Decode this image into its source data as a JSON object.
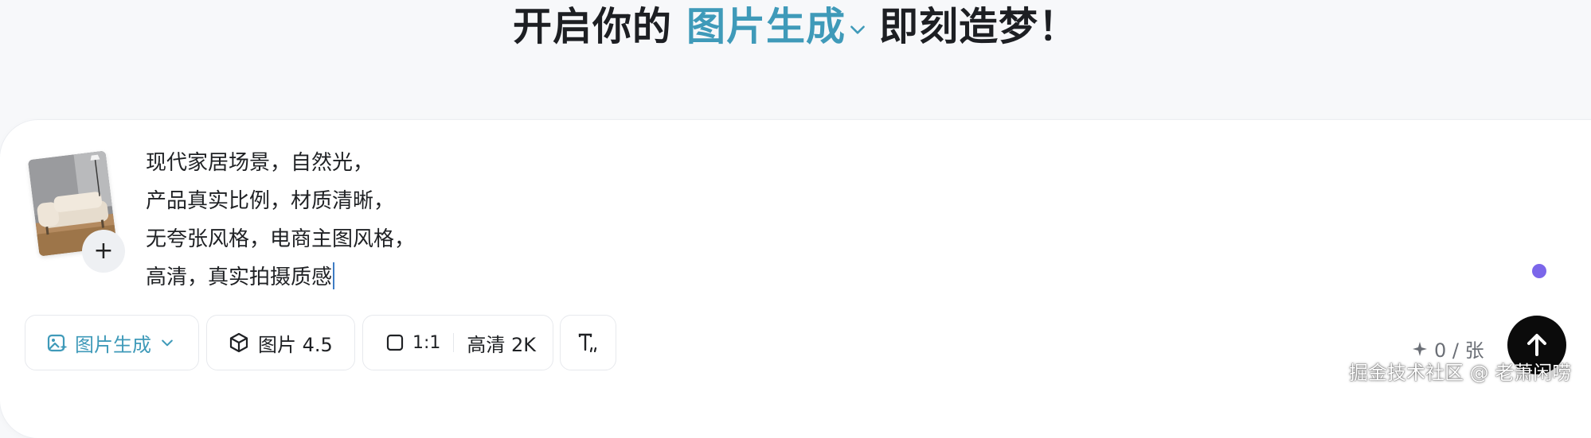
{
  "header": {
    "prefix": "开启你的",
    "mode_link": "图片生成",
    "suffix": "即刻造梦！"
  },
  "colors": {
    "accent": "#3f9ab9",
    "send_button": "#0b0b0b",
    "status_dot": "#7b66ea"
  },
  "composer": {
    "prompt_lines": [
      "现代家居场景，自然光，",
      "产品真实比例，材质清晰，",
      "无夸张风格，电商主图风格，",
      "高清，真实拍摄质感"
    ],
    "add_image_label": "+"
  },
  "toolbar": {
    "mode": "图片生成",
    "model": "图片 4.5",
    "ratio": "1:1",
    "quality": "高清 2K",
    "credits": "0 / 张",
    "icons": {
      "mode": "image-sparkle-icon",
      "model": "cube-icon",
      "ratio": "square-icon",
      "text": "text-style-icon",
      "credits": "sparkle-icon",
      "send": "arrow-up-icon"
    }
  },
  "watermark": "掘金技术社区 @ 老萧闲唠"
}
